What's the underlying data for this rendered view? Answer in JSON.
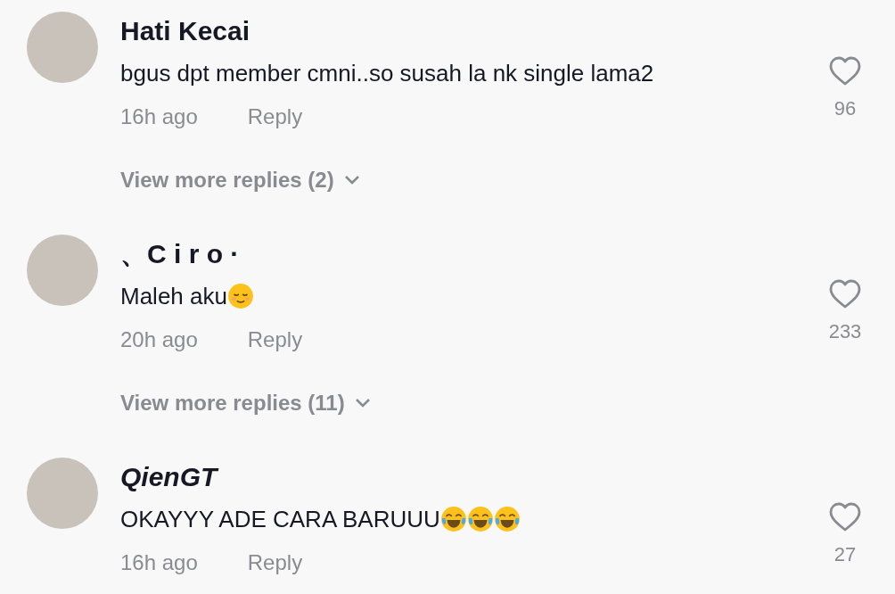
{
  "comments": [
    {
      "username": "Hati Kecai",
      "italic": false,
      "text": "bgus dpt member cmni..so susah la nk single lama2",
      "time": "16h ago",
      "reply": "Reply",
      "likes": "96",
      "more_replies": "View more replies (2)"
    },
    {
      "username": "、C i r o ·",
      "italic": false,
      "text": "Maleh aku",
      "emojis": [
        {
          "kind": "relieved"
        }
      ],
      "time": "20h ago",
      "reply": "Reply",
      "likes": "233",
      "more_replies": "View more replies (11)"
    },
    {
      "username": "QienGT",
      "italic": true,
      "text": "OKAYYY ADE CARA BARUUU",
      "emojis": [
        {
          "kind": "tears-of-joy"
        },
        {
          "kind": "tears-of-joy"
        },
        {
          "kind": "tears-of-joy"
        }
      ],
      "time": "16h ago",
      "reply": "Reply",
      "likes": "27"
    }
  ]
}
